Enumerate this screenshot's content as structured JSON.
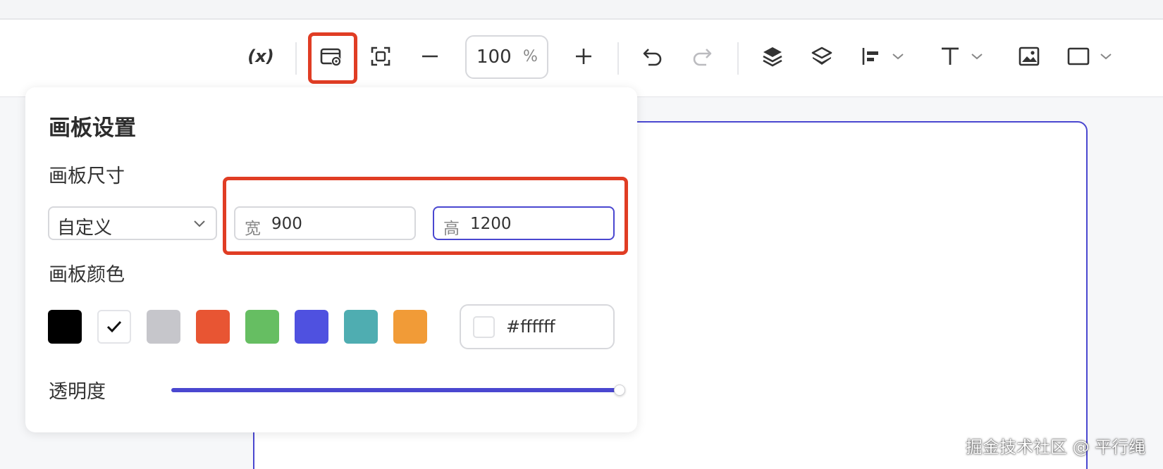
{
  "toolbar": {
    "variable_label": "(x)",
    "zoom_value": "100",
    "zoom_unit": "%",
    "icons": [
      "variable-icon",
      "board-settings-icon",
      "fit-screen-icon",
      "zoom-out-icon",
      "zoom-in-icon",
      "undo-icon",
      "redo-icon",
      "layer-up-icon",
      "layer-down-icon",
      "align-left-icon",
      "text-icon",
      "image-icon",
      "rectangle-icon"
    ]
  },
  "panel": {
    "title": "画板设置",
    "size_label": "画板尺寸",
    "size_preset": "自定义",
    "width_prefix": "宽",
    "width_value": "900",
    "height_prefix": "高",
    "height_value": "1200",
    "color_label": "画板颜色",
    "swatches": [
      "#000000",
      "#ffffff",
      "#c6c6cb",
      "#e85533",
      "#66be62",
      "#4f51e0",
      "#4fadb1",
      "#f19b37"
    ],
    "selected_swatch": "#ffffff",
    "hex_value": "#ffffff",
    "opacity_label": "透明度",
    "opacity": 1.0
  },
  "colors": {
    "accent": "#4a47d0",
    "highlight": "#e03d24"
  },
  "watermark": "掘金技术社区 @ 平行绳"
}
